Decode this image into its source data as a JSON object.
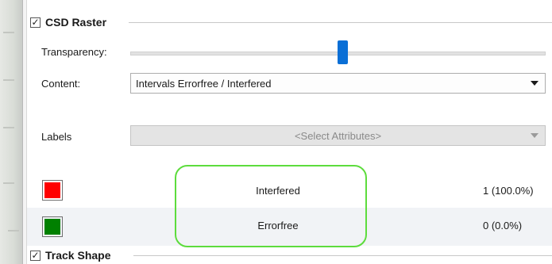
{
  "csd_raster": {
    "title": "CSD Raster",
    "checked": true,
    "transparency_label": "Transparency:",
    "transparency_level": 0.6,
    "content_label": "Content:",
    "content_value": "Intervals Errorfree / Interfered",
    "labels_label": "Labels",
    "labels_placeholder": "<Select Attributes>",
    "legend": [
      {
        "name": "Interfered",
        "count": "1 (100.0%)",
        "color": "#ff0000"
      },
      {
        "name": "Errorfree",
        "count": "0 (0.0%)",
        "color": "#008000"
      }
    ],
    "highlight_color": "#5ddc3d"
  },
  "track_shape": {
    "title": "Track Shape",
    "checked": true
  },
  "accent_color": "#0a6fd6"
}
